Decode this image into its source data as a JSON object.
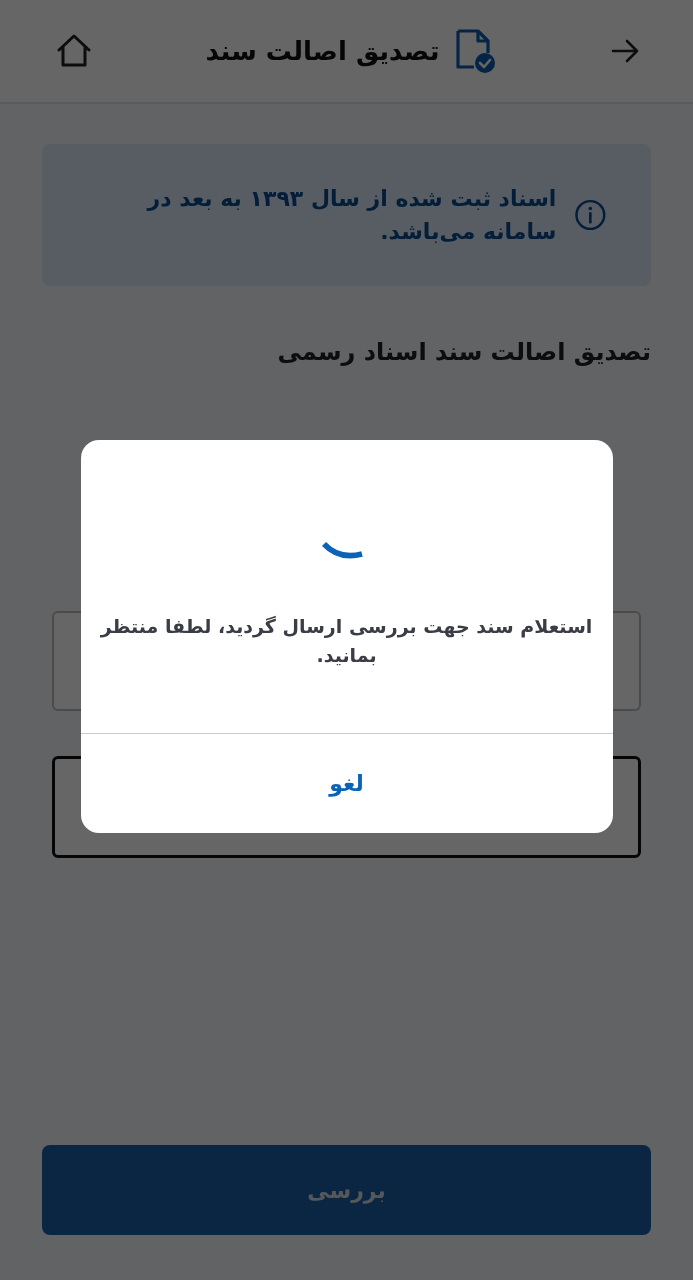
{
  "header": {
    "title": "تصدیق اصالت سند"
  },
  "info_banner": {
    "text": "اسناد ثبت شده از سال ۱۳۹۳ به بعد در سامانه می‌باشد."
  },
  "section_title": "تصدیق اصالت سند اسناد رسمی",
  "fields": [
    {
      "focused": false
    },
    {
      "focused": true
    }
  ],
  "submit_button": {
    "label": "بررسی",
    "disabled": true
  },
  "dialog": {
    "message": "استعلام سند جهت بررسی ارسال گردید، لطفا منتظر بمانید.",
    "cancel_label": "لغو"
  }
}
